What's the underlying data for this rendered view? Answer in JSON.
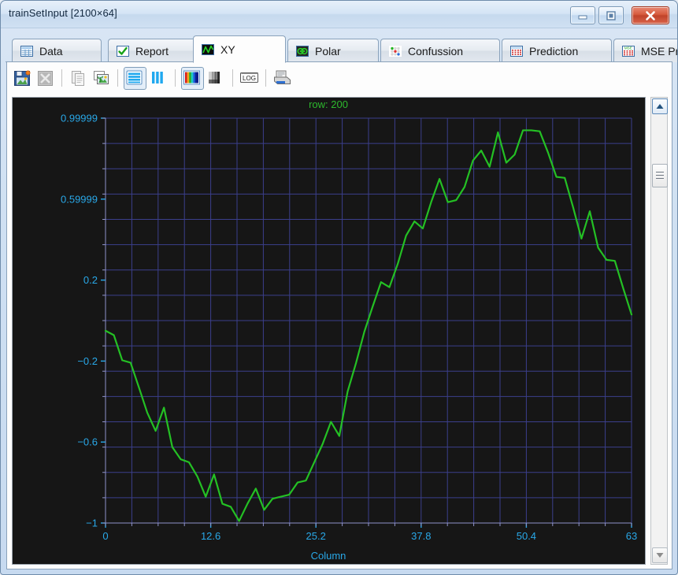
{
  "window": {
    "title": "trainSetInput [2100×64]",
    "buttons": [
      {
        "name": "minimize-button",
        "label": "Minimize"
      },
      {
        "name": "maximize-button",
        "label": "Maximize"
      },
      {
        "name": "close-button",
        "label": "Close"
      }
    ]
  },
  "tabs": [
    {
      "label": "Data",
      "icon": "table-icon",
      "active": false
    },
    {
      "label": "Report",
      "icon": "checkmark-icon",
      "active": false
    },
    {
      "label": "XY",
      "icon": "waveform-icon",
      "active": true
    },
    {
      "label": "Polar",
      "icon": "polar-icon",
      "active": false
    },
    {
      "label": "Confussion",
      "icon": "confusion-dots-icon",
      "active": false
    },
    {
      "label": "Prediction",
      "icon": "grid-red-icon",
      "active": false
    },
    {
      "label": "MSE Pred",
      "icon": "mse-grid-icon",
      "active": false
    }
  ],
  "toolbar": {
    "items": [
      {
        "name": "save-image-button",
        "tip": "Save image",
        "enabled": true,
        "selected": false
      },
      {
        "name": "export-excel-button",
        "tip": "Export to Excel",
        "enabled": false,
        "selected": false
      },
      {
        "name": "copy-button",
        "tip": "Copy",
        "enabled": false,
        "selected": false
      },
      {
        "name": "copy-image-button",
        "tip": "Copy image",
        "enabled": true,
        "selected": false
      },
      {
        "name": "rows-view-button",
        "tip": "Rows",
        "enabled": true,
        "selected": true
      },
      {
        "name": "columns-view-button",
        "tip": "Columns",
        "enabled": true,
        "selected": false
      },
      {
        "name": "color-map-button",
        "tip": "Color map",
        "enabled": true,
        "selected": true
      },
      {
        "name": "gray-map-button",
        "tip": "Gray map",
        "enabled": true,
        "selected": false
      },
      {
        "name": "log-scale-button",
        "tip": "LOG",
        "enabled": true,
        "selected": false
      },
      {
        "name": "print-button",
        "tip": "Print",
        "enabled": true,
        "selected": false
      }
    ],
    "log_label": "LOG"
  },
  "scrollbar": {
    "up_label": "▲",
    "down_label": "▼"
  },
  "colors": {
    "series": "#24c024",
    "grid": "#3b3f8c",
    "axis": "#8f93c9",
    "tick_label": "#29a8e8",
    "plot_bg": "#161616",
    "title": "#2db92d"
  },
  "chart_data": {
    "type": "line",
    "title": "row: 200",
    "xlabel": "Column",
    "ylabel": "",
    "grid": true,
    "legend": "none",
    "xlim": [
      0,
      63
    ],
    "ylim": [
      -1,
      0.99999
    ],
    "xticks": [
      0,
      12.6,
      25.2,
      37.8,
      50.4,
      63
    ],
    "xticklabels": [
      "0",
      "12.6",
      "25.2",
      "37.8",
      "50.4",
      "63"
    ],
    "yticks": [
      0.99999,
      0.59999,
      0.2,
      -0.2,
      -0.6,
      -1
    ],
    "yticklabels": [
      "0.99999",
      "0.59999",
      "0.2",
      "-0.2",
      "-0.6",
      "-1"
    ],
    "x": [
      0,
      1,
      2,
      3,
      4,
      5,
      6,
      7,
      8,
      9,
      10,
      11,
      12,
      13,
      14,
      15,
      16,
      17,
      18,
      19,
      20,
      21,
      22,
      23,
      24,
      25,
      26,
      27,
      28,
      29,
      30,
      31,
      32,
      33,
      34,
      35,
      36,
      37,
      38,
      39,
      40,
      41,
      42,
      43,
      44,
      45,
      46,
      47,
      48,
      49,
      50,
      51,
      52,
      53,
      54,
      55,
      56,
      57,
      58,
      59,
      60,
      61,
      62,
      63
    ],
    "series": [
      {
        "name": "row 200",
        "values": [
          -0.05,
          -0.072,
          -0.196,
          -0.208,
          -0.33,
          -0.455,
          -0.545,
          -0.43,
          -0.625,
          -0.685,
          -0.7,
          -0.77,
          -0.87,
          -0.76,
          -0.905,
          -0.92,
          -0.99,
          -0.905,
          -0.83,
          -0.935,
          -0.88,
          -0.87,
          -0.86,
          -0.8,
          -0.79,
          -0.7,
          -0.61,
          -0.5,
          -0.57,
          -0.35,
          -0.21,
          -0.055,
          0.07,
          0.19,
          0.165,
          0.28,
          0.42,
          0.49,
          0.455,
          0.585,
          0.7,
          0.585,
          0.595,
          0.66,
          0.79,
          0.84,
          0.76,
          0.93,
          0.78,
          0.82,
          0.94,
          0.94,
          0.935,
          0.83,
          0.71,
          0.705,
          0.56,
          0.405,
          0.54,
          0.36,
          0.3,
          0.295,
          0.16,
          0.03
        ]
      }
    ]
  }
}
